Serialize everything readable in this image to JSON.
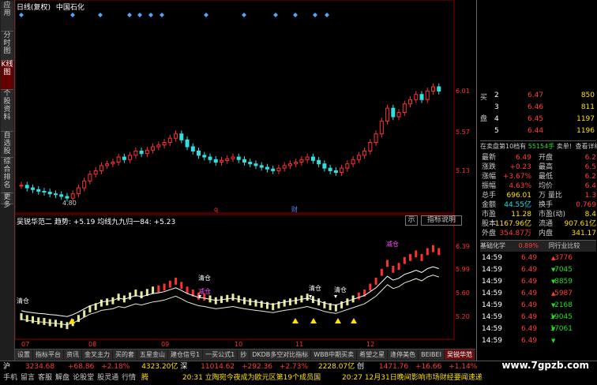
{
  "toolbar": {
    "tabs": [
      "应用",
      "分时图",
      "K线图",
      "个股资料",
      "自选股",
      "综合排名",
      "更多"
    ]
  },
  "main_chart": {
    "title": "日线(复权)",
    "stock": "中国石化",
    "price_labels": [
      "6.01",
      "5.57",
      "5.13"
    ],
    "low_label": "4.80",
    "marker_q": "q",
    "marker_cai": "财"
  },
  "sub_chart": {
    "title": "吴锐华范二 趋势:",
    "v1": "+5.19",
    "v1_label": "均线九九归一84:",
    "v2": "+5.23",
    "indicator_btn": "指标说明",
    "extra_btn": "示",
    "price_labels": [
      "6.39",
      "5.99",
      "5.60",
      "5.20"
    ],
    "labels": {
      "qc1": "清仓",
      "jc1": "减仓",
      "qc2": "清仓",
      "qc3": "清仓",
      "qc4": "清仓",
      "jc2": "减仓"
    }
  },
  "x_axis": [
    "07",
    "08",
    "09",
    "10",
    "11",
    "12"
  ],
  "chart_data": {
    "type": "candlestick",
    "xlabel": "",
    "ylabel": "",
    "x": [
      "07",
      "08",
      "09",
      "10",
      "11",
      "12"
    ],
    "ylim": [
      4.7,
      6.1
    ],
    "close": [
      4.95,
      4.92,
      4.9,
      4.88,
      4.87,
      4.85,
      4.84,
      4.82,
      4.8,
      4.85,
      4.92,
      5.0,
      5.08,
      5.12,
      5.18,
      5.2,
      5.22,
      5.28,
      5.25,
      5.3,
      5.35,
      5.32,
      5.36,
      5.4,
      5.42,
      5.45,
      5.5,
      5.55,
      5.48,
      5.4,
      5.35,
      5.3,
      5.28,
      5.25,
      5.22,
      5.24,
      5.26,
      5.28,
      5.25,
      5.22,
      5.2,
      5.18,
      5.16,
      5.14,
      5.12,
      5.15,
      5.18,
      5.2,
      5.22,
      5.25,
      5.28,
      5.24,
      5.2,
      5.15,
      5.12,
      5.1,
      5.15,
      5.2,
      5.25,
      5.3,
      5.35,
      5.45,
      5.55,
      5.7,
      5.85,
      5.75,
      5.8,
      5.9,
      5.95,
      6.01,
      5.95,
      6.05,
      6.1,
      6.05
    ]
  },
  "quote": {
    "sell_label": [
      "买",
      "盘"
    ],
    "levels": [
      {
        "n": "2",
        "p": "6.47",
        "v": "850"
      },
      {
        "n": "3",
        "p": "6.46",
        "v": "811"
      },
      {
        "n": "4",
        "p": "6.45",
        "v": "1197"
      },
      {
        "n": "5",
        "p": "6.44",
        "v": "1196"
      }
    ],
    "notice_a": "在卖盘第10档有",
    "notice_b": "55154手",
    "notice_c": "卖单!",
    "notice_d": "查看详细",
    "stats": [
      {
        "k": "最新",
        "v": "6.49",
        "k2": "开盘",
        "v2": "6.2"
      },
      {
        "k": "涨跌",
        "v": "+0.23",
        "k2": "最高",
        "v2": "6.5"
      },
      {
        "k": "涨幅",
        "v": "+3.67%",
        "k2": "最低",
        "v2": "6.2"
      },
      {
        "k": "振幅",
        "v": "4.63%",
        "k2": "均价",
        "v2": "6.4"
      },
      {
        "k": "总手",
        "v": "696.01",
        "k2": "万 量比",
        "v2": "1.3"
      },
      {
        "k": "金额",
        "v": "44.55亿",
        "k2": "换手",
        "v2": "0.769"
      },
      {
        "k": "市盈",
        "v": "11.28",
        "k2": "市盈(动)",
        "v2": "8.4"
      },
      {
        "k": "股本",
        "v": "1167.96亿",
        "k2": "流通",
        "v2": "907.61亿"
      },
      {
        "k": "外盘",
        "v": "354.87万",
        "k2": "内盘",
        "v2": "341.17"
      }
    ],
    "tab_a": "基础化学",
    "tab_b": "0.89%",
    "tab_c": "同行业比较",
    "ticks": [
      {
        "t": "14:59",
        "p": "6.49",
        "v": "3776"
      },
      {
        "t": "14:59",
        "p": "6.49",
        "v": "7045"
      },
      {
        "t": "14:59",
        "p": "6.49",
        "v": "8859"
      },
      {
        "t": "14:59",
        "p": "6.49",
        "v": "5987"
      },
      {
        "t": "14:59",
        "p": "6.49",
        "v": "2168"
      },
      {
        "t": "14:59",
        "p": "6.49",
        "v": "19045"
      },
      {
        "t": "14:59",
        "p": "6.49",
        "v": "17061"
      },
      {
        "t": "14:59",
        "p": "6.49",
        "v": ""
      }
    ]
  },
  "bottom_tabs": [
    "设置",
    "指标平台",
    "资讯",
    "金叉主力",
    "买的套",
    "五星金山",
    "建仓信号1",
    "一买公式1",
    "抄",
    "DKDB多空对比指标",
    "WBB中期买卖",
    "希望之星",
    "逢停美色",
    "BEIBEI",
    "吴锐华范"
  ],
  "status": {
    "sh": "沪",
    "sh_val": "3234.68",
    "sh_chg": "+68.86",
    "sh_pct": "+2.18%",
    "sh_amt": "4323.20亿",
    "sz": "深",
    "sz_val": "11014.62",
    "sz_chg": "+292.36",
    "sz_pct": "+2.73%",
    "sz_amt": "2228.07亿",
    "cy": "创",
    "cy_val": "1471.76",
    "cy_chg": "+16.66",
    "cy_pct": "+1.14%",
    "menu": [
      "手机",
      "留言",
      "客服",
      "解盘",
      "论股堂",
      "股灵通",
      "行情"
    ],
    "menu_end": "腾",
    "news1": "20:31 立陶宛今夜成为欧元区第19个成员国",
    "news2": "20:27 12月31日晚间影响市场财经要闻速递",
    "watermark": "www.7gpzb.com"
  }
}
